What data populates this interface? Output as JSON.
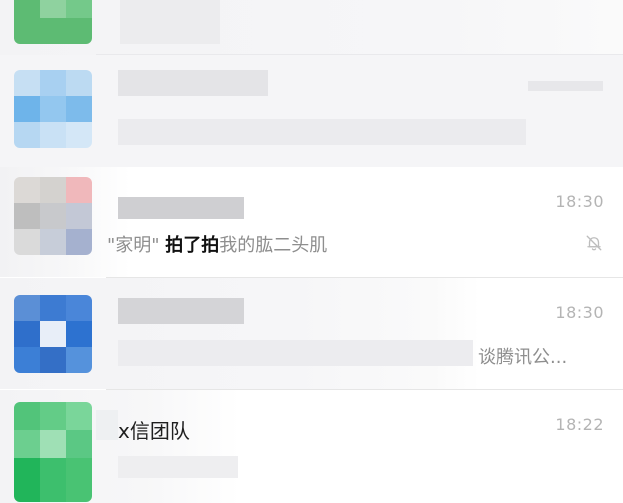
{
  "colors": {
    "row_default": "#ffffff",
    "row_faded": "#f4f4f6",
    "divider": "#e6e6e6",
    "time_gray": "#b4b4b4",
    "preview_gray": "#8e8e8e",
    "name_dark": "#1f1f1f"
  },
  "chats": [
    {
      "name": "",
      "time": "",
      "preview": "",
      "avatar_tone": "green",
      "muted": false
    },
    {
      "name": "",
      "time": "",
      "preview": "",
      "avatar_tone": "blue",
      "muted": false
    },
    {
      "name": "",
      "time": "18:30",
      "preview_prefix": "\"家明\" ",
      "preview_strong": "拍了拍",
      "preview_suffix": "我的肱二头肌",
      "avatar_tone": "grid",
      "muted": true,
      "mute_icon": "bell-off-icon"
    },
    {
      "name": "",
      "time": "18:30",
      "preview": "谈腾讯公...",
      "avatar_tone": "blue",
      "muted": false
    },
    {
      "name": "x信团队",
      "time": "18:22",
      "preview": "",
      "avatar_tone": "green",
      "muted": false
    }
  ]
}
